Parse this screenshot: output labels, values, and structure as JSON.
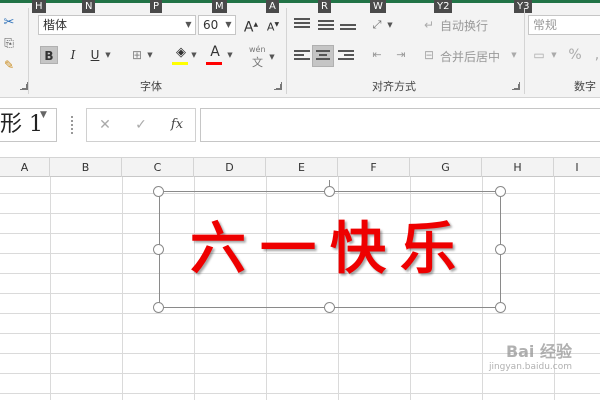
{
  "keytips": [
    "H",
    "N",
    "P",
    "M",
    "A",
    "R",
    "W",
    "Y2",
    "Y3"
  ],
  "font_group": {
    "font_name": "楷体",
    "font_size": "60",
    "bold_label": "B",
    "italic_label": "I",
    "underline_label": "U",
    "grow_font_label": "A",
    "shrink_font_label": "A",
    "wen_label": "wén",
    "wen_char": "文",
    "group_label": "字体"
  },
  "align_group": {
    "wrap_text_label": "自动换行",
    "merge_center_label": "合并后居中",
    "group_label": "对齐方式"
  },
  "number_group": {
    "format_value": "常规",
    "percent_label": "%",
    "comma_label": ",",
    "group_label": "数字"
  },
  "formula_bar": {
    "name_box": "形 1",
    "cancel_label": "✕",
    "enter_label": "✓",
    "fx_label": "fx",
    "formula_value": ""
  },
  "columns": [
    "A",
    "B",
    "C",
    "D",
    "E",
    "F",
    "G",
    "H",
    "I"
  ],
  "textbox": {
    "text": "六一快乐",
    "color": "#ee0000"
  },
  "colors": {
    "accent": "#217346",
    "font_color_bar": "#ff0000"
  },
  "watermark": {
    "main": "Bai 经验",
    "sub": "jingyan.baidu.com"
  }
}
